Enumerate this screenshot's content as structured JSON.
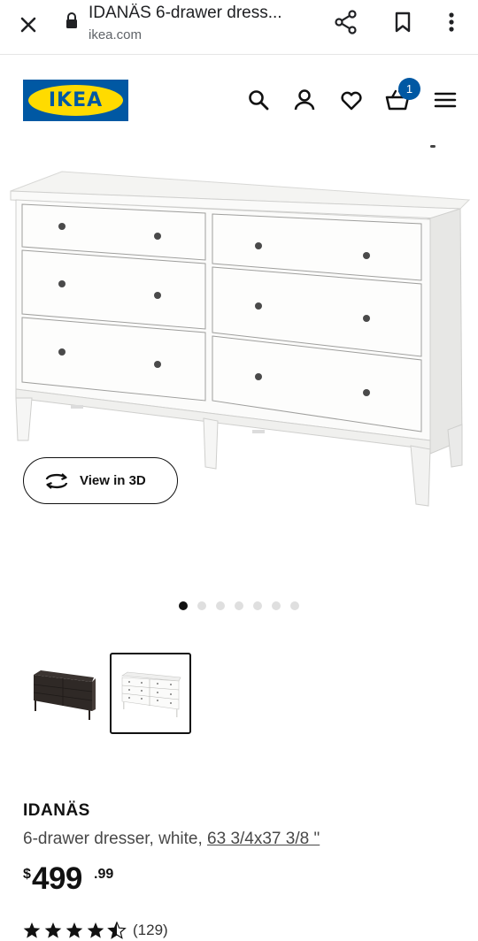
{
  "browser": {
    "title": "IDANÄS 6-drawer dress...",
    "url": "ikea.com",
    "icons": [
      "close-icon",
      "lock-icon",
      "share-icon",
      "bookmark-icon",
      "more-vert-icon"
    ]
  },
  "header": {
    "logo_text": "IKEA",
    "cart_count": "1",
    "icons": [
      "search-icon",
      "user-icon",
      "heart-icon",
      "cart-icon",
      "menu-icon"
    ],
    "brand_blue": "#0058a3",
    "brand_yellow": "#ffdb00"
  },
  "gallery": {
    "view3d_label": "View in 3D",
    "slide_count": 7,
    "active_slide": 1,
    "thumbnails": [
      {
        "label": "dark brown dresser",
        "selected": false
      },
      {
        "label": "white dresser",
        "selected": true
      }
    ]
  },
  "product": {
    "name": "IDANÄS",
    "desc_prefix": "6-drawer dresser, white, ",
    "dimensions": "63 3/4x37 3/8 \"",
    "price_currency": "$",
    "price_int": "499",
    "price_dec": ".99",
    "rating": 4.5,
    "reviews": "(129)"
  }
}
